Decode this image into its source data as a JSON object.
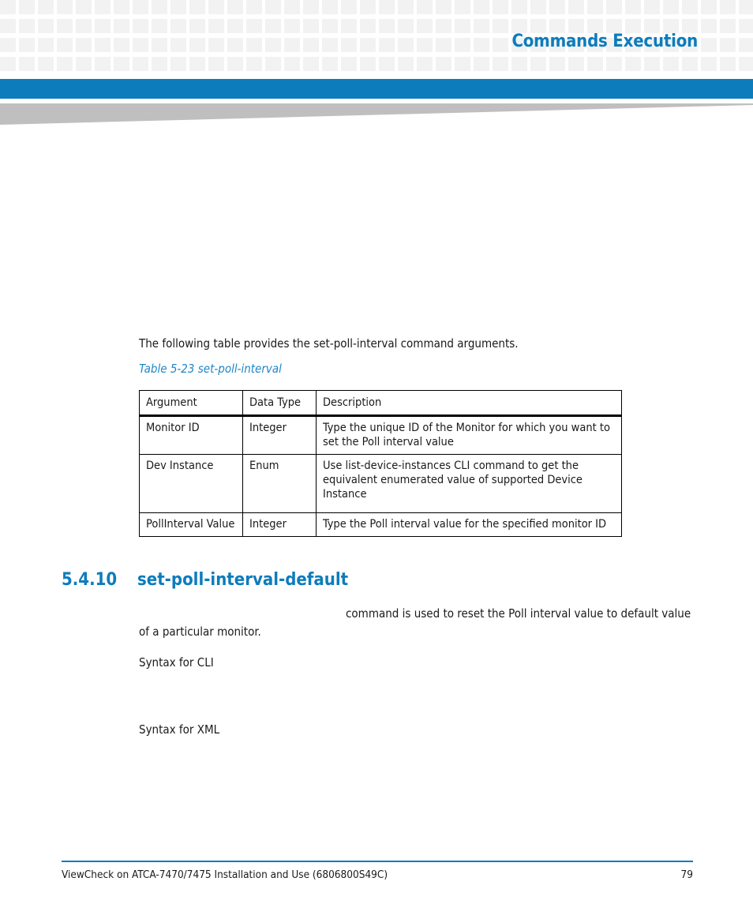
{
  "header": {
    "title": "Commands Execution",
    "accent_color": "#0d7cbc",
    "wedge_color": "#bfbfbf",
    "grid_square_color": "#f2f2f2"
  },
  "body": {
    "intro_paragraph": "The following table provides the set-poll-interval command arguments.",
    "table_caption": "Table 5-23 set-poll-interval",
    "table": {
      "columns": [
        "Argument",
        "Data Type",
        "Description"
      ],
      "rows": [
        {
          "argument": "Monitor ID",
          "data_type": "Integer",
          "description": "Type the unique ID of the Monitor for which you want to set the Poll interval value"
        },
        {
          "argument": "Dev Instance",
          "data_type": "Enum",
          "description": "Use list-device-instances CLI command to get the equivalent enumerated value of supported Device Instance"
        },
        {
          "argument": "PollInterval Value",
          "data_type": "Integer",
          "description": "Type the Poll interval value for the specified monitor ID"
        }
      ]
    },
    "section": {
      "number": "5.4.10",
      "title": "set-poll-interval-default",
      "description_text": "command is used to reset the Poll interval value to default value of a particular monitor.",
      "syntax_cli_label": "Syntax for CLI",
      "syntax_xml_label": "Syntax for XML"
    }
  },
  "footer": {
    "document_title": "ViewCheck on ATCA-7470/7475 Installation and Use (6806800S49C)",
    "page_number": "79",
    "rule_color": "#0d7cbc"
  }
}
